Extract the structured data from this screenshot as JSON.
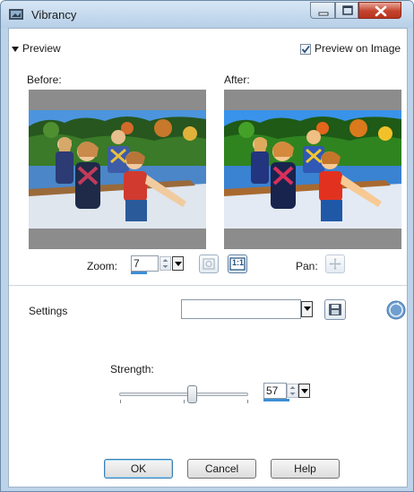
{
  "window": {
    "title": "Vibrancy"
  },
  "preview": {
    "toggle_label": "Preview",
    "preview_on_image_label": "Preview on Image",
    "preview_on_image_checked": true,
    "before_label": "Before:",
    "after_label": "After:"
  },
  "zoom": {
    "label": "Zoom:",
    "value": "7",
    "actual_size_label": "1:1",
    "pan_label": "Pan:"
  },
  "settings": {
    "label": "Settings",
    "selected": ""
  },
  "strength": {
    "label": "Strength:",
    "value": "57",
    "level_percent": 57
  },
  "buttons": {
    "ok": "OK",
    "cancel": "Cancel",
    "help": "Help"
  },
  "colors": {
    "titlebar": "#c8dcf0",
    "close": "#c4432d",
    "accent": "#3c8fd6",
    "frame_gray": "#8c8c8c"
  },
  "icons": [
    "app-icon",
    "minimize-icon",
    "maximize-icon",
    "close-icon",
    "check-icon",
    "spin-arrows-icon",
    "dropdown-arrow-icon",
    "fit-icon",
    "actual-size-icon",
    "pan-icon",
    "save-icon",
    "reset-icon"
  ]
}
